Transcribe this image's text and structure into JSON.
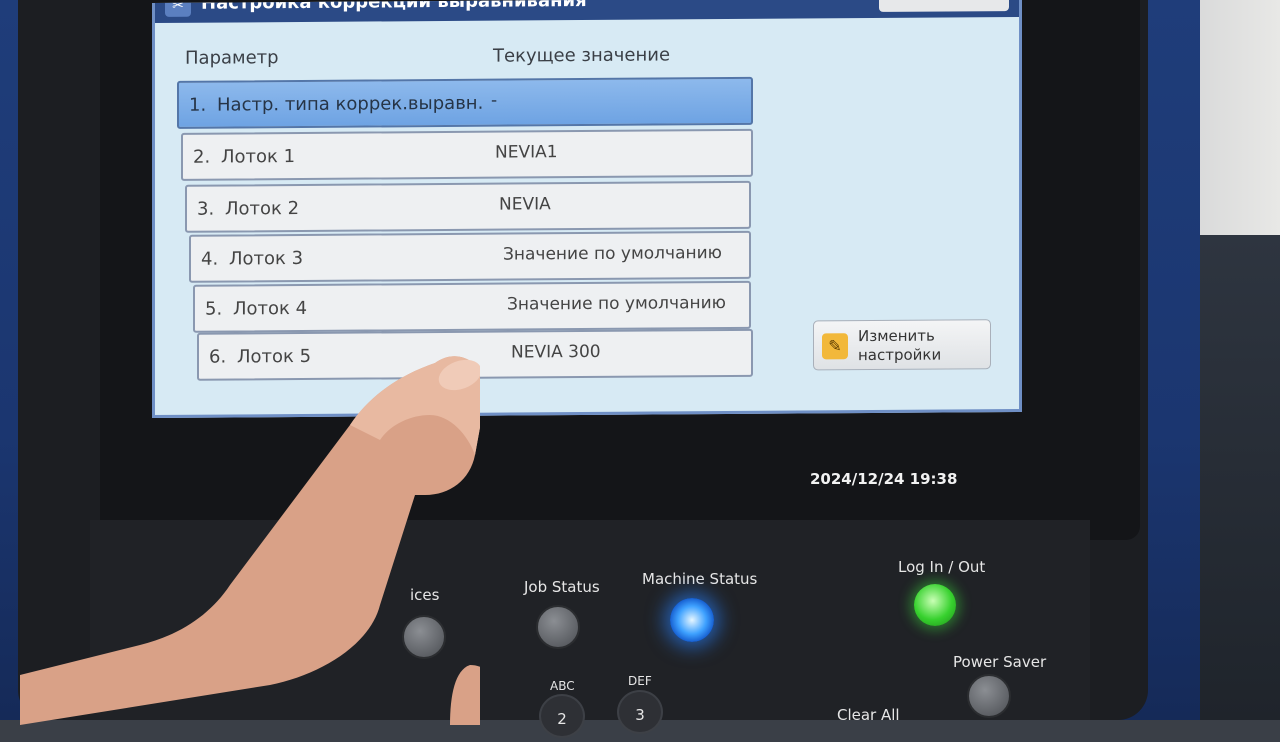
{
  "screen": {
    "title": "Настройка коррекции выравнивания",
    "columns": {
      "param": "Параметр",
      "value": "Текущее значение"
    },
    "rows": [
      {
        "num": "1.",
        "label": "Настр. типа коррек.выравн.",
        "value": "-",
        "selected": true
      },
      {
        "num": "2.",
        "label": "Лоток 1",
        "value": "NEVIA1"
      },
      {
        "num": "3.",
        "label": "Лоток 2",
        "value": "NEVIA"
      },
      {
        "num": "4.",
        "label": "Лоток 3",
        "value": "Значение по умолчанию"
      },
      {
        "num": "5.",
        "label": "Лоток 4",
        "value": "Значение по умолчанию"
      },
      {
        "num": "6.",
        "label": "Лоток 5",
        "value": "NEVIA 300"
      }
    ],
    "edit_button": {
      "line1": "Изменить",
      "line2": "настройки",
      "icon": "pencil-icon"
    },
    "datetime": "2024/12/24  19:38"
  },
  "panel": {
    "services_home": "Services Ho",
    "services": "ices",
    "job_status": "Job Status",
    "machine_status": "Machine Status",
    "log_in_out": "Log In / Out",
    "power_saver": "Power Saver",
    "clear_all": "Clear All",
    "keys": [
      {
        "letters": "ABC",
        "digit": "2"
      },
      {
        "letters": "DEF",
        "digit": "3"
      }
    ]
  },
  "colors": {
    "screen_bg": "#d7eaf4",
    "selected_row": "#7aaee8",
    "machine_status_led": "#3ea1ff",
    "login_led": "#37d12e"
  }
}
